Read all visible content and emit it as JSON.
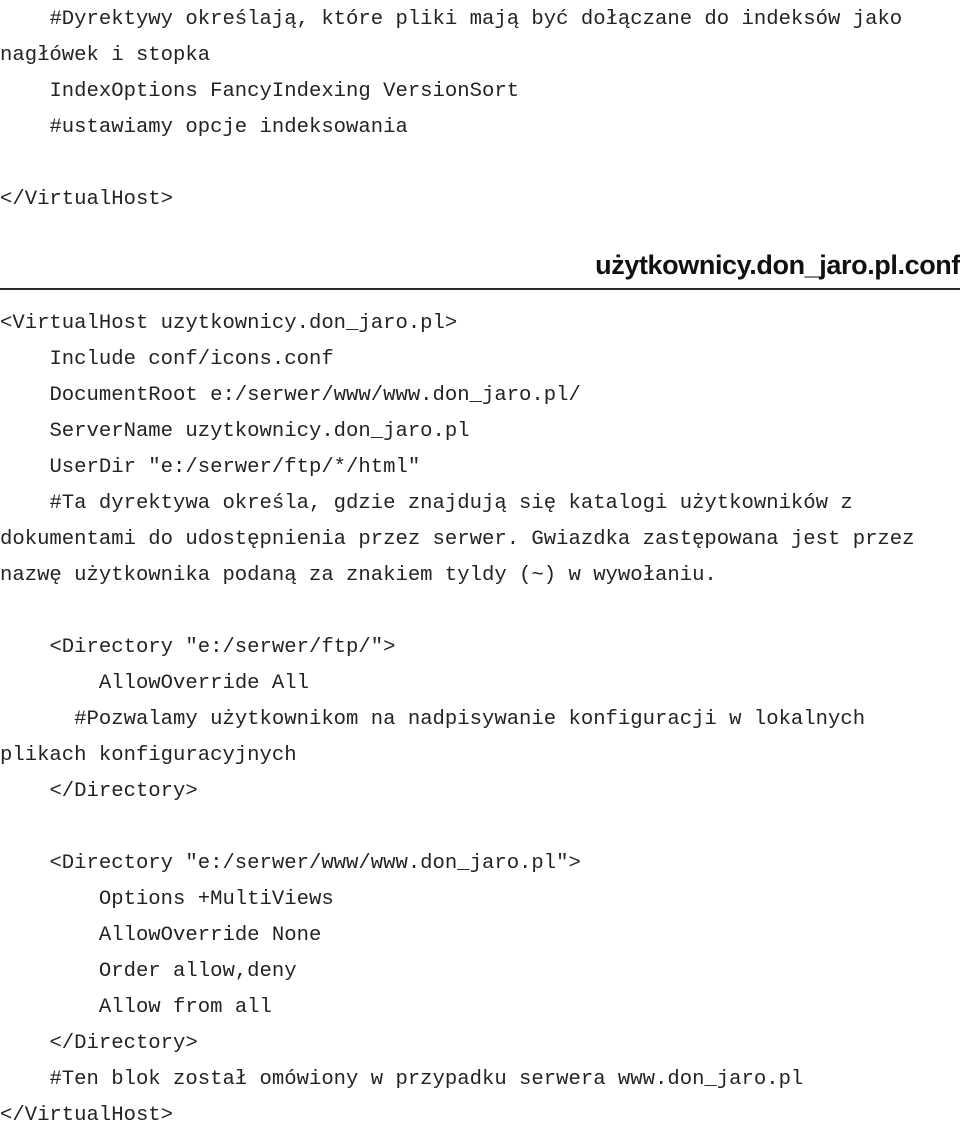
{
  "document": {
    "top_fragment": {
      "lines": [
        "    #Dyrektywy określają, które pliki mają być dołączane do indeksów jako nagłówek i stopka",
        "    IndexOptions FancyIndexing VersionSort",
        "    #ustawiamy opcje indeksowania",
        "",
        "</VirtualHost>"
      ]
    },
    "section": {
      "title": "użytkownicy.don_jaro.pl.conf",
      "rule_color": "#2b2b2b"
    },
    "config": {
      "lines": [
        "<VirtualHost uzytkownicy.don_jaro.pl>",
        "    Include conf/icons.conf",
        "    DocumentRoot e:/serwer/www/www.don_jaro.pl/",
        "    ServerName uzytkownicy.don_jaro.pl",
        "    UserDir \"e:/serwer/ftp/*/html\"",
        "    #Ta dyrektywa określa, gdzie znajdują się katalogi użytkowników z dokumentami do udostępnienia przez serwer. Gwiazdka zastępowana jest przez nazwę użytkownika podaną za znakiem tyldy (~) w wywołaniu.",
        "",
        "    <Directory \"e:/serwer/ftp/\">",
        "        AllowOverride All",
        "      #Pozwalamy użytkownikom na nadpisywanie konfiguracji w lokalnych plikach konfiguracyjnych",
        "    </Directory>",
        "",
        "    <Directory \"e:/serwer/www/www.don_jaro.pl\">",
        "        Options +MultiViews",
        "        AllowOverride None",
        "        Order allow,deny",
        "        Allow from all",
        "    </Directory>",
        "    #Ten blok został omówiony w przypadku serwera www.don_jaro.pl",
        "</VirtualHost>"
      ]
    }
  }
}
